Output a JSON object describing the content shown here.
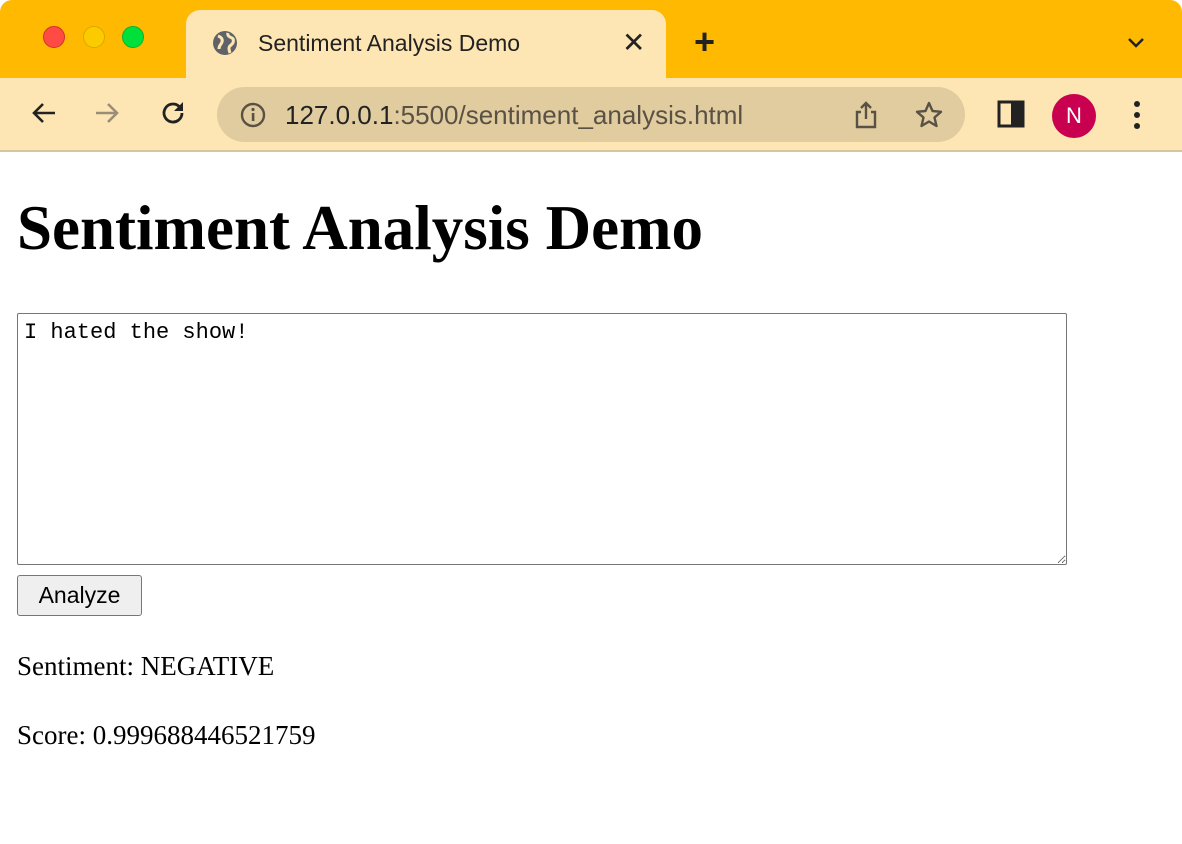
{
  "browser": {
    "tab_title": "Sentiment Analysis Demo",
    "url_host": "127.0.0.1",
    "url_rest": ":5500/sentiment_analysis.html",
    "profile_initial": "N",
    "colors": {
      "tabbar": "#ffb900",
      "toolbar": "#fde6b4",
      "avatar": "#c9004f"
    }
  },
  "page": {
    "heading": "Sentiment Analysis Demo",
    "textarea_value": "I hated the show!",
    "analyze_label": "Analyze",
    "sentiment_line": "Sentiment: NEGATIVE",
    "score_line": "Score: 0.999688446521759"
  }
}
